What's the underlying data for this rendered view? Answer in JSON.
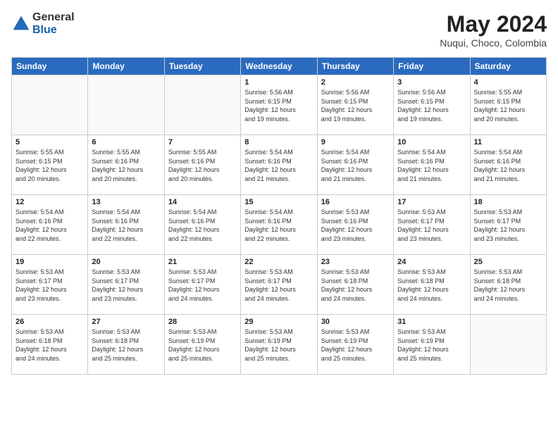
{
  "header": {
    "logo_general": "General",
    "logo_blue": "Blue",
    "month_year": "May 2024",
    "location": "Nuqui, Choco, Colombia"
  },
  "days_of_week": [
    "Sunday",
    "Monday",
    "Tuesday",
    "Wednesday",
    "Thursday",
    "Friday",
    "Saturday"
  ],
  "weeks": [
    [
      {
        "day": "",
        "info": ""
      },
      {
        "day": "",
        "info": ""
      },
      {
        "day": "",
        "info": ""
      },
      {
        "day": "1",
        "info": "Sunrise: 5:56 AM\nSunset: 6:15 PM\nDaylight: 12 hours\nand 19 minutes."
      },
      {
        "day": "2",
        "info": "Sunrise: 5:56 AM\nSunset: 6:15 PM\nDaylight: 12 hours\nand 19 minutes."
      },
      {
        "day": "3",
        "info": "Sunrise: 5:56 AM\nSunset: 6:15 PM\nDaylight: 12 hours\nand 19 minutes."
      },
      {
        "day": "4",
        "info": "Sunrise: 5:55 AM\nSunset: 6:15 PM\nDaylight: 12 hours\nand 20 minutes."
      }
    ],
    [
      {
        "day": "5",
        "info": "Sunrise: 5:55 AM\nSunset: 6:15 PM\nDaylight: 12 hours\nand 20 minutes."
      },
      {
        "day": "6",
        "info": "Sunrise: 5:55 AM\nSunset: 6:16 PM\nDaylight: 12 hours\nand 20 minutes."
      },
      {
        "day": "7",
        "info": "Sunrise: 5:55 AM\nSunset: 6:16 PM\nDaylight: 12 hours\nand 20 minutes."
      },
      {
        "day": "8",
        "info": "Sunrise: 5:54 AM\nSunset: 6:16 PM\nDaylight: 12 hours\nand 21 minutes."
      },
      {
        "day": "9",
        "info": "Sunrise: 5:54 AM\nSunset: 6:16 PM\nDaylight: 12 hours\nand 21 minutes."
      },
      {
        "day": "10",
        "info": "Sunrise: 5:54 AM\nSunset: 6:16 PM\nDaylight: 12 hours\nand 21 minutes."
      },
      {
        "day": "11",
        "info": "Sunrise: 5:54 AM\nSunset: 6:16 PM\nDaylight: 12 hours\nand 21 minutes."
      }
    ],
    [
      {
        "day": "12",
        "info": "Sunrise: 5:54 AM\nSunset: 6:16 PM\nDaylight: 12 hours\nand 22 minutes."
      },
      {
        "day": "13",
        "info": "Sunrise: 5:54 AM\nSunset: 6:16 PM\nDaylight: 12 hours\nand 22 minutes."
      },
      {
        "day": "14",
        "info": "Sunrise: 5:54 AM\nSunset: 6:16 PM\nDaylight: 12 hours\nand 22 minutes."
      },
      {
        "day": "15",
        "info": "Sunrise: 5:54 AM\nSunset: 6:16 PM\nDaylight: 12 hours\nand 22 minutes."
      },
      {
        "day": "16",
        "info": "Sunrise: 5:53 AM\nSunset: 6:16 PM\nDaylight: 12 hours\nand 23 minutes."
      },
      {
        "day": "17",
        "info": "Sunrise: 5:53 AM\nSunset: 6:17 PM\nDaylight: 12 hours\nand 23 minutes."
      },
      {
        "day": "18",
        "info": "Sunrise: 5:53 AM\nSunset: 6:17 PM\nDaylight: 12 hours\nand 23 minutes."
      }
    ],
    [
      {
        "day": "19",
        "info": "Sunrise: 5:53 AM\nSunset: 6:17 PM\nDaylight: 12 hours\nand 23 minutes."
      },
      {
        "day": "20",
        "info": "Sunrise: 5:53 AM\nSunset: 6:17 PM\nDaylight: 12 hours\nand 23 minutes."
      },
      {
        "day": "21",
        "info": "Sunrise: 5:53 AM\nSunset: 6:17 PM\nDaylight: 12 hours\nand 24 minutes."
      },
      {
        "day": "22",
        "info": "Sunrise: 5:53 AM\nSunset: 6:17 PM\nDaylight: 12 hours\nand 24 minutes."
      },
      {
        "day": "23",
        "info": "Sunrise: 5:53 AM\nSunset: 6:18 PM\nDaylight: 12 hours\nand 24 minutes."
      },
      {
        "day": "24",
        "info": "Sunrise: 5:53 AM\nSunset: 6:18 PM\nDaylight: 12 hours\nand 24 minutes."
      },
      {
        "day": "25",
        "info": "Sunrise: 5:53 AM\nSunset: 6:18 PM\nDaylight: 12 hours\nand 24 minutes."
      }
    ],
    [
      {
        "day": "26",
        "info": "Sunrise: 5:53 AM\nSunset: 6:18 PM\nDaylight: 12 hours\nand 24 minutes."
      },
      {
        "day": "27",
        "info": "Sunrise: 5:53 AM\nSunset: 6:18 PM\nDaylight: 12 hours\nand 25 minutes."
      },
      {
        "day": "28",
        "info": "Sunrise: 5:53 AM\nSunset: 6:19 PM\nDaylight: 12 hours\nand 25 minutes."
      },
      {
        "day": "29",
        "info": "Sunrise: 5:53 AM\nSunset: 6:19 PM\nDaylight: 12 hours\nand 25 minutes."
      },
      {
        "day": "30",
        "info": "Sunrise: 5:53 AM\nSunset: 6:19 PM\nDaylight: 12 hours\nand 25 minutes."
      },
      {
        "day": "31",
        "info": "Sunrise: 5:53 AM\nSunset: 6:19 PM\nDaylight: 12 hours\nand 25 minutes."
      },
      {
        "day": "",
        "info": ""
      }
    ]
  ]
}
